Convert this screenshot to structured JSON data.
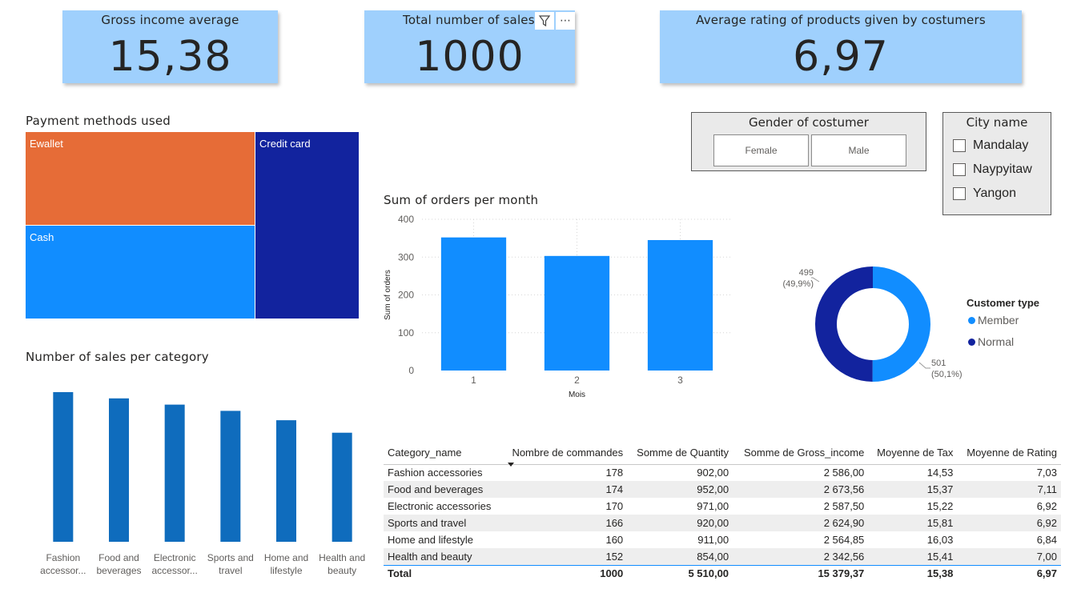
{
  "kpis": {
    "gross_income": {
      "title": "Gross income average",
      "value": "15,38"
    },
    "total_sales": {
      "title": "Total number of sales",
      "value": "1000"
    },
    "avg_rating": {
      "title": "Average rating of products given by costumers",
      "value": "6,97"
    }
  },
  "card_tools": {
    "filter_icon": "filter-icon",
    "more_icon": "more-options-icon",
    "more_glyph": "⋯"
  },
  "payment": {
    "title": "Payment methods used",
    "items": [
      {
        "label": "Ewallet",
        "color": "#e66c37"
      },
      {
        "label": "Cash",
        "color": "#118dff"
      },
      {
        "label": "Credit card",
        "color": "#12239e"
      }
    ]
  },
  "gender_slicer": {
    "title": "Gender of costumer",
    "options": [
      "Female",
      "Male"
    ]
  },
  "city_slicer": {
    "title": "City name",
    "options": [
      "Mandalay",
      "Naypyitaw",
      "Yangon"
    ]
  },
  "chart_data": [
    {
      "type": "bar",
      "title": "Sum of orders per month",
      "xlabel": "Mois",
      "ylabel": "Sum of orders",
      "categories": [
        "1",
        "2",
        "3"
      ],
      "values": [
        352,
        303,
        345
      ],
      "ylim": [
        0,
        400
      ],
      "yticks": [
        "0",
        "100",
        "200",
        "300",
        "400"
      ],
      "grid": true,
      "color": "#118dff"
    },
    {
      "type": "bar",
      "title": "Number of sales per category",
      "categories": [
        "Fashion accessor...",
        "Food and beverages",
        "Electronic accessor...",
        "Sports and travel",
        "Home and lifestyle",
        "Health and beauty"
      ],
      "values": [
        178,
        174,
        170,
        166,
        160,
        152
      ],
      "color": "#0f6cbd"
    },
    {
      "type": "pie",
      "title": "",
      "legend_title": "Customer type",
      "legend_position": "right",
      "series": [
        {
          "name": "Member",
          "value": 501,
          "label": "501",
          "percent": "(50,1%)",
          "color": "#118dff"
        },
        {
          "name": "Normal",
          "value": 499,
          "label": "499",
          "percent": "(49,9%)",
          "color": "#12239e"
        }
      ]
    }
  ],
  "table": {
    "columns": [
      "Category_name",
      "Nombre de commandes",
      "Somme de Quantity",
      "Somme de Gross_income",
      "Moyenne de Tax",
      "Moyenne de Rating"
    ],
    "rows": [
      [
        "Fashion accessories",
        "178",
        "902,00",
        "2 586,00",
        "14,53",
        "7,03"
      ],
      [
        "Food and beverages",
        "174",
        "952,00",
        "2 673,56",
        "15,37",
        "7,11"
      ],
      [
        "Electronic accessories",
        "170",
        "971,00",
        "2 587,50",
        "15,22",
        "6,92"
      ],
      [
        "Sports and travel",
        "166",
        "920,00",
        "2 624,90",
        "15,81",
        "6,92"
      ],
      [
        "Home and lifestyle",
        "160",
        "911,00",
        "2 564,85",
        "16,03",
        "6,84"
      ],
      [
        "Health and beauty",
        "152",
        "854,00",
        "2 342,56",
        "15,41",
        "7,00"
      ]
    ],
    "total": [
      "Total",
      "1000",
      "5 510,00",
      "15 379,37",
      "15,38",
      "6,97"
    ]
  }
}
